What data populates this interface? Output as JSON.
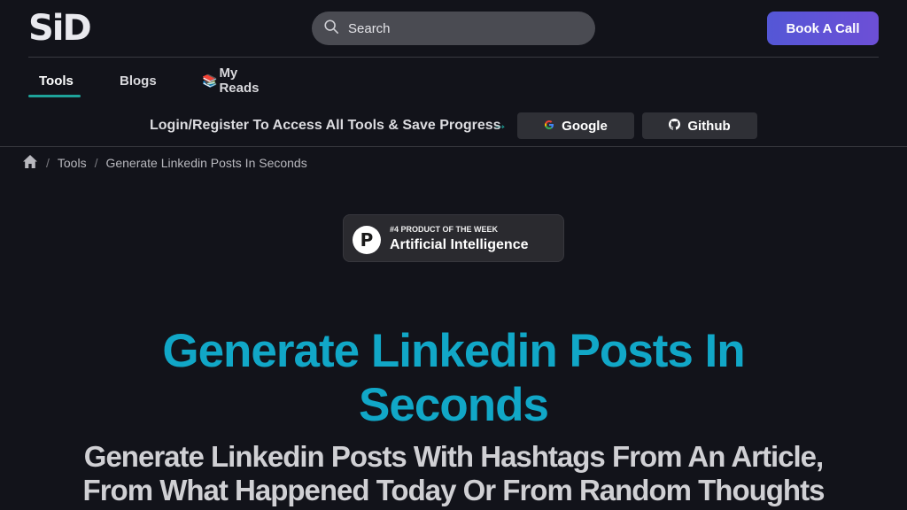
{
  "header": {
    "logo": "SiD",
    "search": {
      "placeholder": "Search"
    },
    "book_call": "Book A Call"
  },
  "nav": {
    "tabs": [
      {
        "label": "Tools",
        "active": true
      },
      {
        "label": "Blogs",
        "active": false
      },
      {
        "label": "My Reads",
        "emoji": "📚",
        "active": false
      }
    ]
  },
  "login": {
    "text": "Login/Register To Access All Tools & Save Progress",
    "arrow": "→",
    "google": "Google",
    "github": "Github"
  },
  "breadcrumb": {
    "items": [
      "Tools",
      "Generate Linkedin Posts In Seconds"
    ],
    "separator": "/"
  },
  "badge": {
    "logo_letter": "P",
    "line1": "#4 PRODUCT OF THE WEEK",
    "line2": "Artificial Intelligence"
  },
  "hero": {
    "title_line1": "Generate Linkedin Posts In",
    "title_line2": "Seconds",
    "subtitle_line1": "Generate Linkedin Posts With Hashtags From An Article,",
    "subtitle_line2": "From What Happened Today Or From Random Thoughts"
  },
  "colors": {
    "accent": "#11a7c7",
    "teal": "#1ea39a",
    "button_gradient_start": "#5457d6",
    "button_gradient_end": "#6d4fd6",
    "background": "#12131a"
  }
}
